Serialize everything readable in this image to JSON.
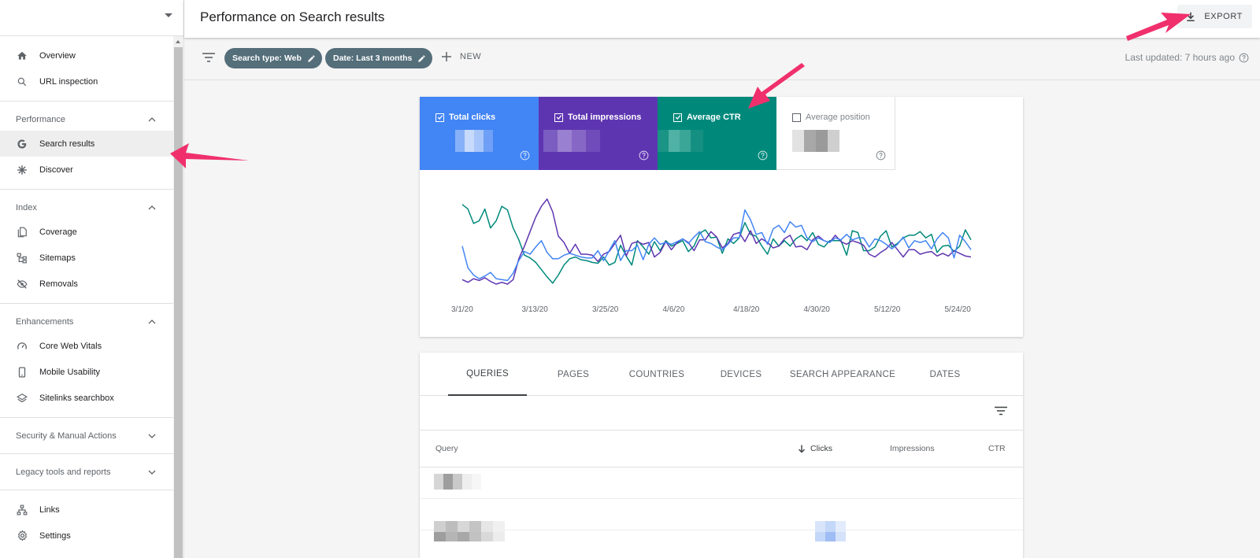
{
  "header": {
    "title": "Performance on Search results",
    "export_label": "EXPORT"
  },
  "sidebar": {
    "top_items": [
      {
        "label": "Overview",
        "icon": "home-icon"
      },
      {
        "label": "URL inspection",
        "icon": "search-icon"
      }
    ],
    "sections": [
      {
        "title": "Performance",
        "expanded": true,
        "items": [
          {
            "label": "Search results",
            "icon": "google-g-icon",
            "active": true
          },
          {
            "label": "Discover",
            "icon": "asterisk-icon"
          }
        ]
      },
      {
        "title": "Index",
        "expanded": true,
        "items": [
          {
            "label": "Coverage",
            "icon": "pages-icon"
          },
          {
            "label": "Sitemaps",
            "icon": "sitemap-icon"
          },
          {
            "label": "Removals",
            "icon": "eye-off-icon"
          }
        ]
      },
      {
        "title": "Enhancements",
        "expanded": true,
        "items": [
          {
            "label": "Core Web Vitals",
            "icon": "gauge-icon"
          },
          {
            "label": "Mobile Usability",
            "icon": "phone-icon"
          },
          {
            "label": "Sitelinks searchbox",
            "icon": "layers-icon"
          }
        ]
      },
      {
        "title": "Security & Manual Actions",
        "expanded": false,
        "items": []
      },
      {
        "title": "Legacy tools and reports",
        "expanded": false,
        "items": []
      }
    ],
    "bottom_items": [
      {
        "label": "Links",
        "icon": "links-icon"
      },
      {
        "label": "Settings",
        "icon": "gear-icon"
      }
    ]
  },
  "filters": {
    "chips": [
      "Search type: Web",
      "Date: Last 3 months"
    ],
    "new_label": "NEW",
    "last_updated": "Last updated: 7 hours ago"
  },
  "metrics": [
    {
      "label": "Total clicks",
      "checked": true,
      "color": "#4285f4"
    },
    {
      "label": "Total impressions",
      "checked": true,
      "color": "#5e35b1"
    },
    {
      "label": "Average CTR",
      "checked": true,
      "color": "#00897b"
    },
    {
      "label": "Average position",
      "checked": false,
      "color": "#ffffff"
    }
  ],
  "chart_data": {
    "type": "line",
    "x_tick_labels": [
      "3/1/20",
      "3/13/20",
      "3/25/20",
      "4/6/20",
      "4/18/20",
      "4/30/20",
      "5/12/20",
      "5/24/20"
    ],
    "x_range": [
      "3/1/20",
      "5/30/20"
    ],
    "y_axis_shown": false,
    "grid": false,
    "series": [
      {
        "color": "#00897b",
        "relative_values": [
          0.88,
          0.83,
          0.67,
          0.7,
          0.83,
          0.62,
          0.7,
          0.86,
          0.82,
          0.62,
          0.49,
          0.32,
          0.29,
          0.24,
          0.16,
          0.08,
          0.01,
          0.1,
          0.21,
          0.28,
          0.3,
          0.27,
          0.26,
          0.24,
          0.23,
          0.3,
          0.21,
          0.24,
          0.43,
          0.31,
          0.21,
          0.48,
          0.41,
          0.33,
          0.47,
          0.37,
          0.48,
          0.42,
          0.45,
          0.48,
          0.36,
          0.42,
          0.56,
          0.6,
          0.51,
          0.52,
          0.34,
          0.5,
          0.45,
          0.51,
          0.68,
          0.55,
          0.53,
          0.42,
          0.33,
          0.5,
          0.42,
          0.48,
          0.42,
          0.5,
          0.54,
          0.48,
          0.57,
          0.44,
          0.41,
          0.48,
          0.48,
          0.48,
          0.32,
          0.59,
          0.57,
          0.37,
          0.37,
          0.41,
          0.53,
          0.59,
          0.41,
          0.45,
          0.51,
          0.54,
          0.54,
          0.58,
          0.51,
          0.55,
          0.35,
          0.42,
          0.43,
          0.36,
          0.42,
          0.6,
          0.49
        ]
      },
      {
        "color": "#5e35b1",
        "relative_values": [
          0.05,
          0.02,
          0.06,
          0.04,
          0.07,
          0.03,
          0.0,
          0.02,
          0.0,
          0.05,
          0.28,
          0.42,
          0.58,
          0.74,
          0.86,
          0.94,
          0.8,
          0.53,
          0.46,
          0.34,
          0.44,
          0.33,
          0.33,
          0.32,
          0.25,
          0.33,
          0.36,
          0.45,
          0.54,
          0.31,
          0.45,
          0.47,
          0.44,
          0.46,
          0.3,
          0.35,
          0.47,
          0.38,
          0.46,
          0.5,
          0.46,
          0.37,
          0.49,
          0.49,
          0.58,
          0.52,
          0.4,
          0.45,
          0.55,
          0.57,
          0.47,
          0.59,
          0.45,
          0.5,
          0.46,
          0.4,
          0.42,
          0.5,
          0.54,
          0.41,
          0.42,
          0.38,
          0.49,
          0.53,
          0.48,
          0.46,
          0.54,
          0.47,
          0.44,
          0.48,
          0.46,
          0.43,
          0.33,
          0.3,
          0.35,
          0.39,
          0.46,
          0.38,
          0.3,
          0.38,
          0.38,
          0.33,
          0.35,
          0.36,
          0.31,
          0.34,
          0.31,
          0.37,
          0.34,
          0.31,
          0.3
        ]
      },
      {
        "color": "#4285f4",
        "relative_values": [
          0.42,
          0.18,
          0.1,
          0.06,
          0.09,
          0.13,
          0.06,
          0.05,
          0.04,
          0.12,
          0.26,
          0.36,
          0.33,
          0.41,
          0.48,
          0.35,
          0.28,
          0.28,
          0.32,
          0.34,
          0.32,
          0.3,
          0.29,
          0.29,
          0.37,
          0.26,
          0.37,
          0.48,
          0.26,
          0.37,
          0.37,
          0.43,
          0.27,
          0.44,
          0.51,
          0.44,
          0.46,
          0.44,
          0.47,
          0.5,
          0.45,
          0.52,
          0.58,
          0.47,
          0.45,
          0.41,
          0.38,
          0.44,
          0.51,
          0.51,
          0.82,
          0.71,
          0.55,
          0.57,
          0.44,
          0.61,
          0.65,
          0.57,
          0.69,
          0.63,
          0.65,
          0.51,
          0.47,
          0.51,
          0.48,
          0.46,
          0.51,
          0.49,
          0.55,
          0.49,
          0.51,
          0.51,
          0.41,
          0.5,
          0.48,
          0.44,
          0.39,
          0.44,
          0.52,
          0.4,
          0.48,
          0.46,
          0.48,
          0.39,
          0.5,
          0.57,
          0.51,
          0.29,
          0.54,
          0.47,
          0.38
        ]
      }
    ]
  },
  "tabs": [
    "QUERIES",
    "PAGES",
    "COUNTRIES",
    "DEVICES",
    "SEARCH APPEARANCE",
    "DATES"
  ],
  "active_tab": "QUERIES",
  "table": {
    "columns": [
      "Query",
      "Clicks",
      "Impressions",
      "CTR"
    ],
    "sort_column": "Clicks",
    "sort_direction": "descending"
  }
}
